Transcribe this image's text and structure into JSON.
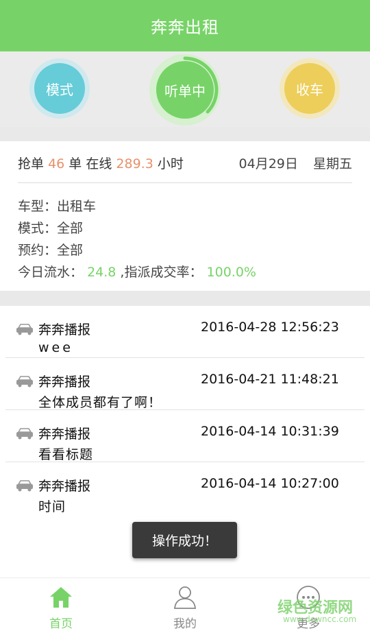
{
  "header": {
    "title": "奔奔出租"
  },
  "controls": {
    "mode_label": "模式",
    "listening_label": "听单中",
    "close_label": "收车"
  },
  "stats": {
    "grab_prefix": "抢单",
    "grab_count": "46",
    "grab_unit": "单",
    "online_prefix": "在线",
    "online_hours": "289.3",
    "online_unit": "小时",
    "date": "04月29日",
    "weekday": "星期五"
  },
  "info": {
    "car_type": "车型：出租车",
    "mode": "模式：全部",
    "reservation": "预约：全部",
    "flow_prefix": "今日流水：",
    "flow_value": "24.8",
    "rate_prefix": ",指派成交率：",
    "rate_value": "100.0%"
  },
  "news": [
    {
      "title": "奔奔播报",
      "time": "2016-04-28 12:56:23",
      "body": "wee"
    },
    {
      "title": "奔奔播报",
      "time": "2016-04-21 11:48:21",
      "body": "全体成员都有了啊！"
    },
    {
      "title": "奔奔播报",
      "time": "2016-04-14 10:31:39",
      "body": "看看标题"
    },
    {
      "title": "奔奔播报",
      "time": "2016-04-14 10:27:00",
      "body": "时间"
    }
  ],
  "toast": {
    "message": "操作成功！"
  },
  "bottom_nav": {
    "home": "首页",
    "mine": "我的",
    "more": "更多"
  },
  "watermark": {
    "main": "绿色资源网",
    "sub": "www.downcc.com"
  },
  "colors": {
    "brand_green": "#77d367",
    "mode_blue": "#66ccd8",
    "close_yellow": "#edce5a",
    "accent_orange": "#e8906a",
    "toast_bg": "#3a3a3a"
  }
}
